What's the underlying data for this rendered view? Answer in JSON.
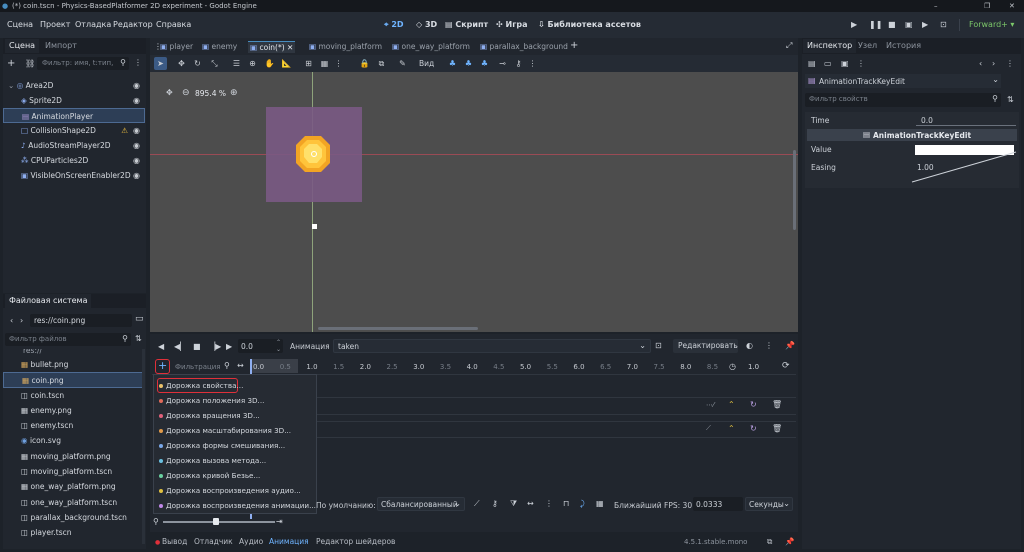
{
  "window": {
    "title": "(*) coin.tscn - Physics-BasedPlatformer 2D experiment - Godot Engine",
    "controls": [
      "–",
      "❐",
      "✕"
    ]
  },
  "menu": {
    "items": [
      "Сцена",
      "Проект",
      "Отладка",
      "Редактор",
      "Справка"
    ],
    "workspaces": {
      "w2d": "2D",
      "w3d": "3D",
      "script": "Скрипт",
      "game": "Игра",
      "assets": "Библиотека ассетов"
    },
    "renderer": "Forward+"
  },
  "scene_dock": {
    "tabs": {
      "scene": "Сцена",
      "import": "Импорт"
    },
    "filter_placeholder": "Фильтр: имя, t:тип,",
    "nodes": [
      {
        "name": "Area2D",
        "icon": "◎",
        "color": "#8eaef0"
      },
      {
        "name": "Sprite2D",
        "icon": "◈",
        "color": "#8eaef0"
      },
      {
        "name": "AnimationPlayer",
        "icon": "▤",
        "color": "#b99fe0"
      },
      {
        "name": "CollisionShape2D",
        "icon": "□",
        "color": "#8eaef0"
      },
      {
        "name": "AudioStreamPlayer2D",
        "icon": "♪",
        "color": "#8eaef0"
      },
      {
        "name": "CPUParticles2D",
        "icon": "⁂",
        "color": "#8eaef0"
      },
      {
        "name": "VisibleOnScreenEnabler2D",
        "icon": "▣",
        "color": "#8eaef0"
      }
    ],
    "warning": "⚠"
  },
  "filesystem": {
    "title": "Файловая система",
    "path": "res://coin.png",
    "filter_placeholder": "Фильтр файлов",
    "folder": "res://",
    "files": [
      {
        "name": "bullet.png",
        "icon": "▦",
        "color": "#e0b060"
      },
      {
        "name": "coin.png",
        "icon": "▦",
        "color": "#e0b060"
      },
      {
        "name": "coin.tscn",
        "icon": "◫",
        "color": "#d7dbe1"
      },
      {
        "name": "enemy.png",
        "icon": "▦",
        "color": "#d7dbe1"
      },
      {
        "name": "enemy.tscn",
        "icon": "◫",
        "color": "#d7dbe1"
      },
      {
        "name": "icon.svg",
        "icon": "◉",
        "color": "#6fa0e0"
      },
      {
        "name": "moving_platform.png",
        "icon": "▦",
        "color": "#d7dbe1"
      },
      {
        "name": "moving_platform.tscn",
        "icon": "◫",
        "color": "#d7dbe1"
      },
      {
        "name": "one_way_platform.png",
        "icon": "▦",
        "color": "#d7dbe1"
      },
      {
        "name": "one_way_platform.tscn",
        "icon": "◫",
        "color": "#d7dbe1"
      },
      {
        "name": "parallax_background.tscn",
        "icon": "◫",
        "color": "#d7dbe1"
      },
      {
        "name": "player.tscn",
        "icon": "◫",
        "color": "#d7dbe1"
      }
    ]
  },
  "scene_tabs": [
    "player",
    "enemy",
    "coin(*)",
    "moving_platform",
    "one_way_platform",
    "parallax_background"
  ],
  "toolbar": {
    "view": "Вид"
  },
  "viewport": {
    "zoom": "895.4 %"
  },
  "animation": {
    "time": "0.0",
    "anim_label": "Анимация",
    "anim_name": "taken",
    "edit": "Редактировать",
    "filter_placeholder": "Фильтрация",
    "length": "1.0",
    "ticks": [
      "0.0",
      "0.5",
      "1.0",
      "1.5",
      "2.0",
      "2.5",
      "3.0",
      "3.5",
      "4.0",
      "4.5",
      "5.0",
      "5.5",
      "6.0",
      "6.5",
      "7.0",
      "7.5",
      "8.0",
      "8.5"
    ],
    "default_label": "По умолчанию:",
    "interp": "Сбалансированный",
    "fps_label": "Ближайший FPS: 30",
    "step": "0.0333",
    "unit": "Секунды"
  },
  "track_menu": [
    {
      "label": "Дорожка свойства...",
      "color": "#e8c06a"
    },
    {
      "label": "Дорожка положения 3D...",
      "color": "#e06a5a"
    },
    {
      "label": "Дорожка вращения 3D...",
      "color": "#e0607a"
    },
    {
      "label": "Дорожка масштабирования 3D...",
      "color": "#e09a4a"
    },
    {
      "label": "Дорожка формы смешивания...",
      "color": "#7aa8e8"
    },
    {
      "label": "Дорожка вызова метода...",
      "color": "#6ac0e0"
    },
    {
      "label": "Дорожка кривой Безье...",
      "color": "#6ad0a0"
    },
    {
      "label": "Дорожка воспроизведения аудио...",
      "color": "#e0c040"
    },
    {
      "label": "Дорожка воспроизведения анимации...",
      "color": "#c088e8"
    }
  ],
  "bottom_tabs": [
    "Вывод",
    "Отладчик",
    "Аудио",
    "Анимация",
    "Редактор шейдеров"
  ],
  "version": "4.5.1.stable.mono",
  "inspector": {
    "tabs": {
      "inspector": "Инспектор",
      "node": "Узел",
      "history": "История"
    },
    "object": "AnimationTrackKeyEdit",
    "filter_placeholder": "Фильтр свойств",
    "props": {
      "time_label": "Time",
      "time_value": "0.0",
      "section": "AnimationTrackKeyEdit",
      "value_label": "Value",
      "easing_label": "Easing",
      "easing_value": "1.00"
    }
  },
  "colors": {
    "accent": "#478cbf",
    "highlight": "#e0303a",
    "selected": "#2d3e56"
  }
}
